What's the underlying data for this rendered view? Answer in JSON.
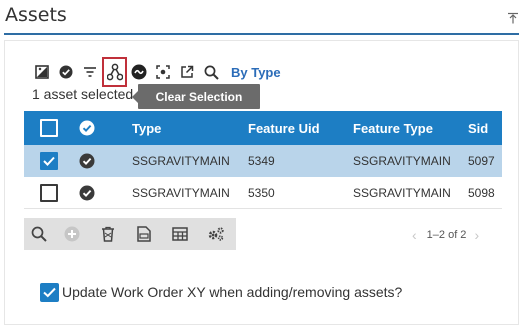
{
  "panel": {
    "title": "Assets"
  },
  "toolbar": {
    "by_type_label": "By Type"
  },
  "selection": {
    "count_text": "1 asset selected"
  },
  "tooltip": {
    "text": "Clear Selection"
  },
  "grid": {
    "columns": [
      "Type",
      "Feature Uid",
      "Feature Type",
      "Sid"
    ],
    "rows": [
      {
        "type": "SSGRAVITYMAIN",
        "feature_uid": "5349",
        "feature_type": "SSGRAVITYMAIN",
        "sid": "5097",
        "selected": true
      },
      {
        "type": "SSGRAVITYMAIN",
        "feature_uid": "5350",
        "feature_type": "SSGRAVITYMAIN",
        "sid": "5098",
        "selected": false
      }
    ]
  },
  "pager": {
    "range_text": "1–2 of 2"
  },
  "options": {
    "update_xy_label": "Update Work Order XY when adding/removing assets?",
    "update_xy_checked": true
  },
  "colors": {
    "accent": "#1d7ec4",
    "selected_row": "#b9d4ea",
    "tooltip_bg": "#6b6b6b",
    "active_border": "#c0303a"
  }
}
